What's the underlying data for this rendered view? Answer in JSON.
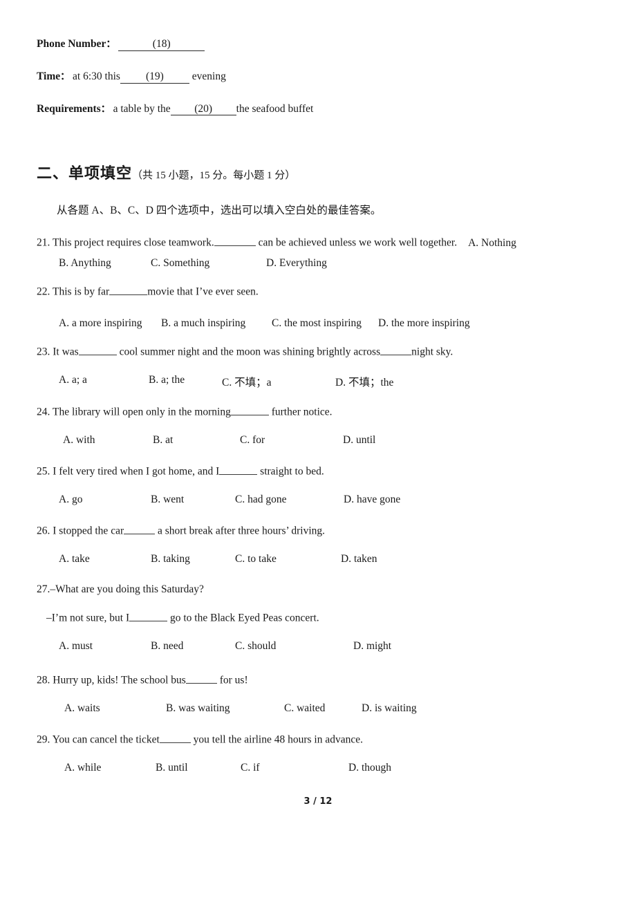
{
  "document": {
    "page_footer": "3 / 12"
  },
  "form_block": {
    "rows": [
      {
        "label": "Phone Number",
        "colon": "：",
        "before": "",
        "blank": "(18)",
        "after": ""
      },
      {
        "label": "Time",
        "colon": "：",
        "before": "at 6:30 this",
        "blank": "(19)",
        "after": "evening"
      },
      {
        "label": "Requirements",
        "colon": "：",
        "before": "a table by the",
        "blank": "(20)",
        "after": "the seafood buffet"
      }
    ]
  },
  "section": {
    "title": "二、单项填空",
    "note": "（共 15 小题，15 分。每小题 1 分）",
    "instruction": "从各题 A、B、C、D 四个选项中，选出可以填入空白处的最佳答案。"
  },
  "questions": [
    {
      "number": "21.",
      "stem_before": "This project requires close teamwork.",
      "stem_after": "can be achieved unless we work well together.",
      "trailing_option": "A. Nothing",
      "options": [
        "B. Anything",
        "C. Something",
        "D. Everything"
      ]
    },
    {
      "number": "22.",
      "stem_before": "This is by far",
      "stem_after": "movie that I’ve ever seen.",
      "options": [
        "A. a more inspiring",
        "B. a much inspiring",
        "C. the most inspiring",
        "D. the more inspiring"
      ]
    },
    {
      "number": "23.",
      "stem_before": "It was",
      "stem_mid": "cool summer night and the moon was shining brightly across",
      "stem_after": "night sky.",
      "options": [
        "A. a; a",
        "B. a; the",
        "C. 不填；a",
        "D. 不填；the"
      ]
    },
    {
      "number": "24.",
      "stem_before": "The library will open only in the morning",
      "stem_after": "further notice.",
      "options": [
        "A. with",
        "B. at",
        "C. for",
        "D. until"
      ]
    },
    {
      "number": "25.",
      "stem_before": "I felt very tired when I got home, and I",
      "stem_after": "straight to bed.",
      "options": [
        "A. go",
        "B. went",
        "C. had gone",
        "D. have gone"
      ]
    },
    {
      "number": "26.",
      "stem_before": "I stopped the car",
      "stem_after": "a short break after three hours’ driving.",
      "options": [
        "A. take",
        "B. taking",
        "C. to take",
        "D. taken"
      ]
    },
    {
      "number": "27.",
      "stem_line1": "–What are you doing this Saturday?",
      "stem_before": "–I’m not sure, but I",
      "stem_after": "go to the Black Eyed Peas concert.",
      "options": [
        "A. must",
        "B. need",
        "C. should",
        "D. might"
      ]
    },
    {
      "number": "28.",
      "stem_before": "Hurry up, kids! The school bus",
      "stem_after": "for us!",
      "options": [
        "A. waits",
        "B. was waiting",
        "C. waited",
        "D. is waiting"
      ]
    },
    {
      "number": "29.",
      "stem_before": "You can cancel the ticket",
      "stem_after": "you tell the airline 48 hours in advance.",
      "options": [
        "A. while",
        "B. until",
        "C. if",
        "D. though"
      ]
    }
  ]
}
